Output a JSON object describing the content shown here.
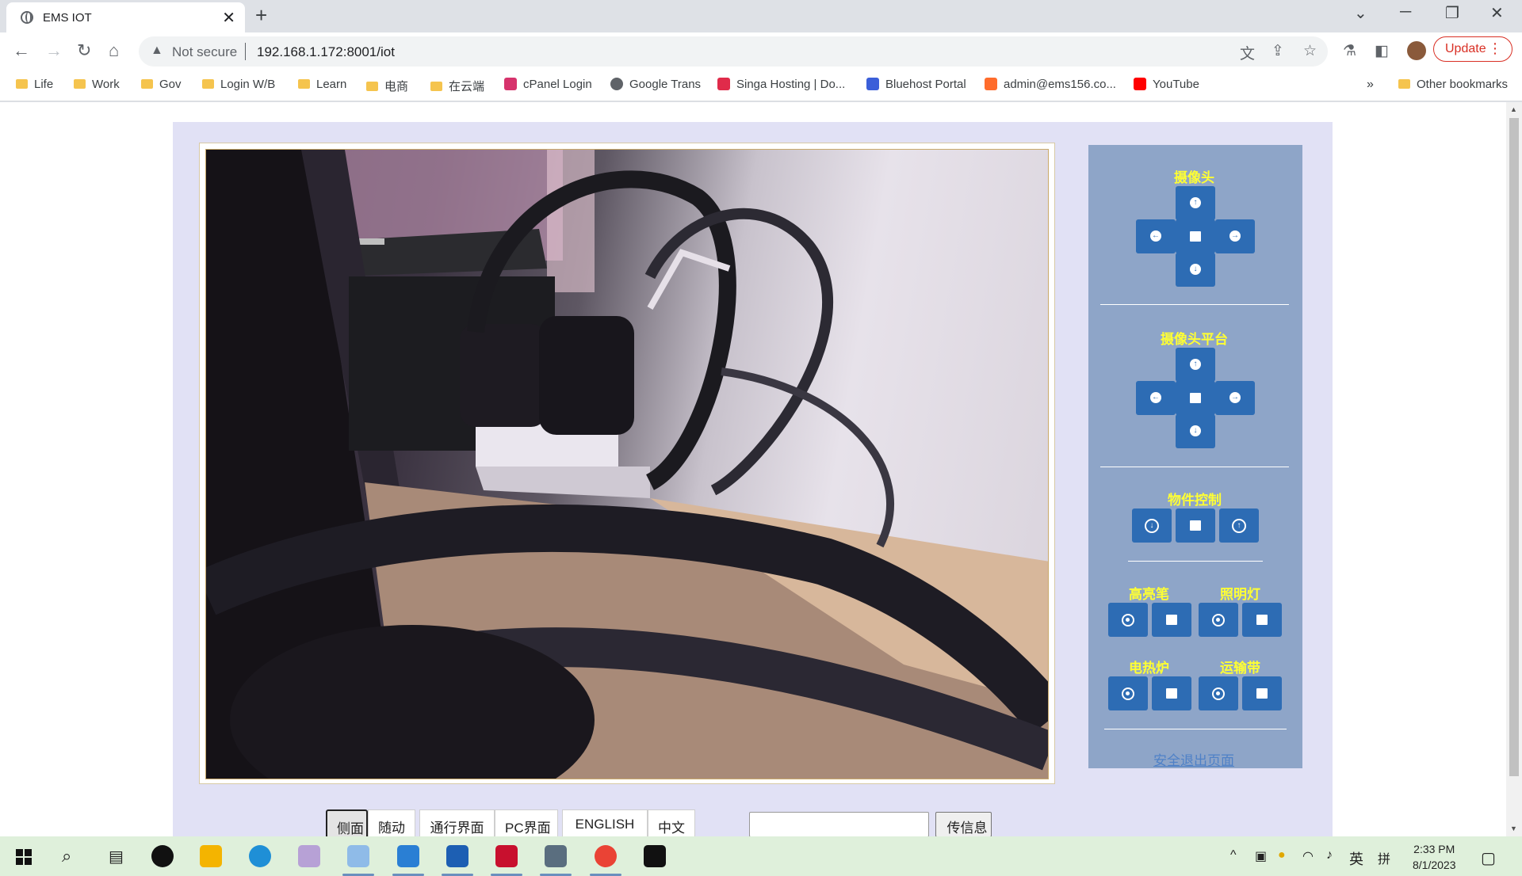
{
  "browser": {
    "tab_title": "EMS IOT",
    "address_warning": "Not secure",
    "url": "192.168.1.172:8001/iot",
    "update_label": "Update",
    "bookmarks": [
      {
        "label": "Life",
        "icon": "folder-icon"
      },
      {
        "label": "Work",
        "icon": "folder-icon"
      },
      {
        "label": "Gov",
        "icon": "folder-icon"
      },
      {
        "label": "Login W/B",
        "icon": "folder-icon"
      },
      {
        "label": "Learn",
        "icon": "folder-icon"
      },
      {
        "label": "电商",
        "icon": "folder-icon"
      },
      {
        "label": "在云端",
        "icon": "folder-icon"
      },
      {
        "label": "cPanel Login",
        "icon": "cpanel-icon"
      },
      {
        "label": "Google Trans",
        "icon": "globe-icon"
      },
      {
        "label": "Singa Hosting | Do...",
        "icon": "singa-icon"
      },
      {
        "label": "Bluehost Portal",
        "icon": "grid-icon"
      },
      {
        "label": "admin@ems156.co...",
        "icon": "cpanel-icon"
      },
      {
        "label": "YouTube",
        "icon": "youtube-icon"
      }
    ],
    "more_bookmarks": "»",
    "other_bookmarks": "Other bookmarks"
  },
  "page": {
    "controls": {
      "side": "侧面",
      "follow": "随动",
      "pass_ui": "通行界面",
      "pc_ui": "PC界面",
      "english": "ENGLISH",
      "chinese": "中文",
      "message_value": "",
      "send": "传信息"
    },
    "panel": {
      "camera_title": "摄像头",
      "platform_title": "摄像头平台",
      "object_title": "物件控制",
      "highlighter_title": "高亮笔",
      "light_title": "照明灯",
      "heater_title": "电热炉",
      "conveyor_title": "运输带",
      "exit_link": "安全退出页面"
    }
  },
  "taskbar": {
    "time": "2:33 PM",
    "date": "8/1/2023",
    "ime_lang": "英",
    "ime_mode": "拼"
  },
  "colors": {
    "panel_bg": "#8ea5c8",
    "panel_button": "#2d6cb4",
    "panel_title": "#ffff33",
    "page_bg": "#e1e1f5",
    "update_red": "#d93025"
  }
}
